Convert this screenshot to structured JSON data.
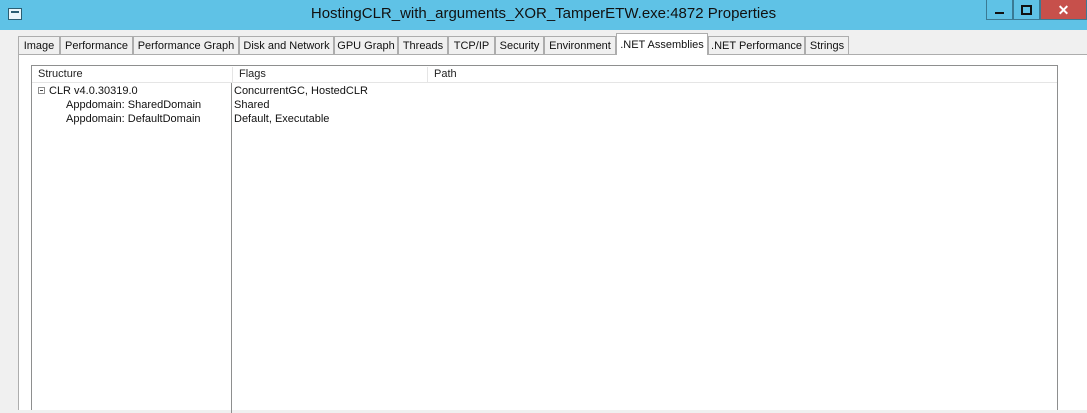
{
  "window": {
    "title": "HostingCLR_with_arguments_XOR_TamperETW.exe:4872 Properties",
    "icons": [
      "window-icon",
      "minimize-icon",
      "maximize-icon",
      "close-icon"
    ]
  },
  "tabs": [
    {
      "label": "Image"
    },
    {
      "label": "Performance"
    },
    {
      "label": "Performance Graph"
    },
    {
      "label": "Disk and Network"
    },
    {
      "label": "GPU Graph"
    },
    {
      "label": "Threads"
    },
    {
      "label": "TCP/IP"
    },
    {
      "label": "Security"
    },
    {
      "label": "Environment"
    },
    {
      "label": ".NET Assemblies",
      "active": true
    },
    {
      "label": ".NET Performance"
    },
    {
      "label": "Strings"
    }
  ],
  "columns": {
    "structure": "Structure",
    "flags": "Flags",
    "path": "Path"
  },
  "rows": [
    {
      "structure": "CLR v4.0.30319.0",
      "flags": "ConcurrentGC, HostedCLR",
      "path": "",
      "expanded": true
    },
    {
      "structure": "Appdomain: SharedDomain",
      "flags": "Shared",
      "path": ""
    },
    {
      "structure": "Appdomain: DefaultDomain",
      "flags": "Default, Executable",
      "path": ""
    }
  ],
  "colors": {
    "titlebar": "#5fc2e6",
    "close": "#c7504b"
  }
}
